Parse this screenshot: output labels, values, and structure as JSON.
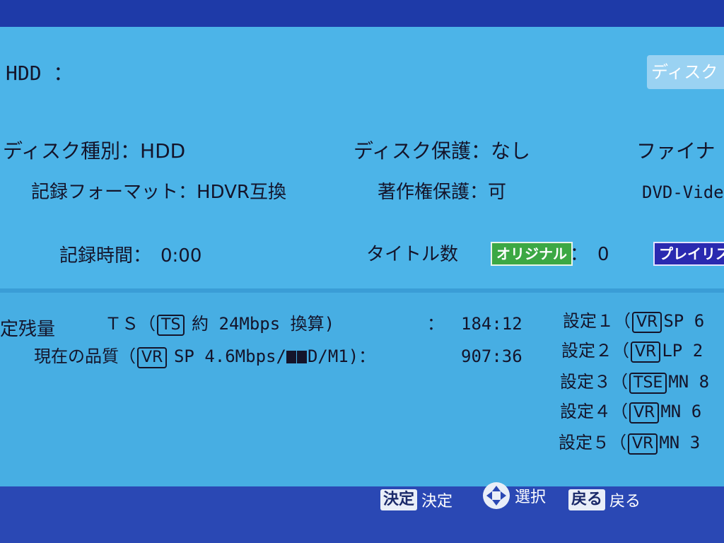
{
  "media": {
    "label": "HDD ："
  },
  "tab": {
    "label": "ディスク"
  },
  "info": {
    "disc_type": "ディスク種別：HDD",
    "disc_protect": "ディスク保護：なし",
    "finalize": "ファイナ",
    "format": "記録フォーマット：HDVR互換",
    "copyright": "著作権保護：可",
    "dvd_video": "DVD-Vide",
    "rec_time": "記録時間：　0:00",
    "title_count": "タイトル数",
    "original_badge": "オリジナル",
    "original_count": "：　0",
    "playlist_badge": "プレイリスト"
  },
  "remaining": {
    "heading": "定残量",
    "ts_prefix": "ＴＳ（",
    "ts_box": "TS",
    "ts_text": "約 24Mbps 換算)",
    "ts_colon": "：",
    "ts_time": "184:12",
    "quality_prefix": "現在の品質（",
    "quality_box": "VR",
    "quality_text": "SP 4.6Mbps/",
    "quality_suffix": "D/M1)：",
    "quality_time": "907:36"
  },
  "settings": [
    {
      "label": "設定１（",
      "box": "VR",
      "value": "SP 6"
    },
    {
      "label": "設定２（",
      "box": "VR",
      "value": "LP 2"
    },
    {
      "label": "設定３（",
      "box": "TSE",
      "value": "MN 8"
    },
    {
      "label": "設定４（",
      "box": "VR",
      "value": "MN 6"
    },
    {
      "label": "設定５（",
      "box": "VR",
      "value": "MN 3"
    }
  ],
  "footer": {
    "enter_key": "決定",
    "enter_label": "決定",
    "select_label": "選択",
    "back_key": "戻る",
    "back_label": "戻る"
  },
  "colors": {
    "panel": "#47aee3",
    "frame": "#1d3db0",
    "original": "#3ca844",
    "playlist": "#2a2ab0"
  }
}
